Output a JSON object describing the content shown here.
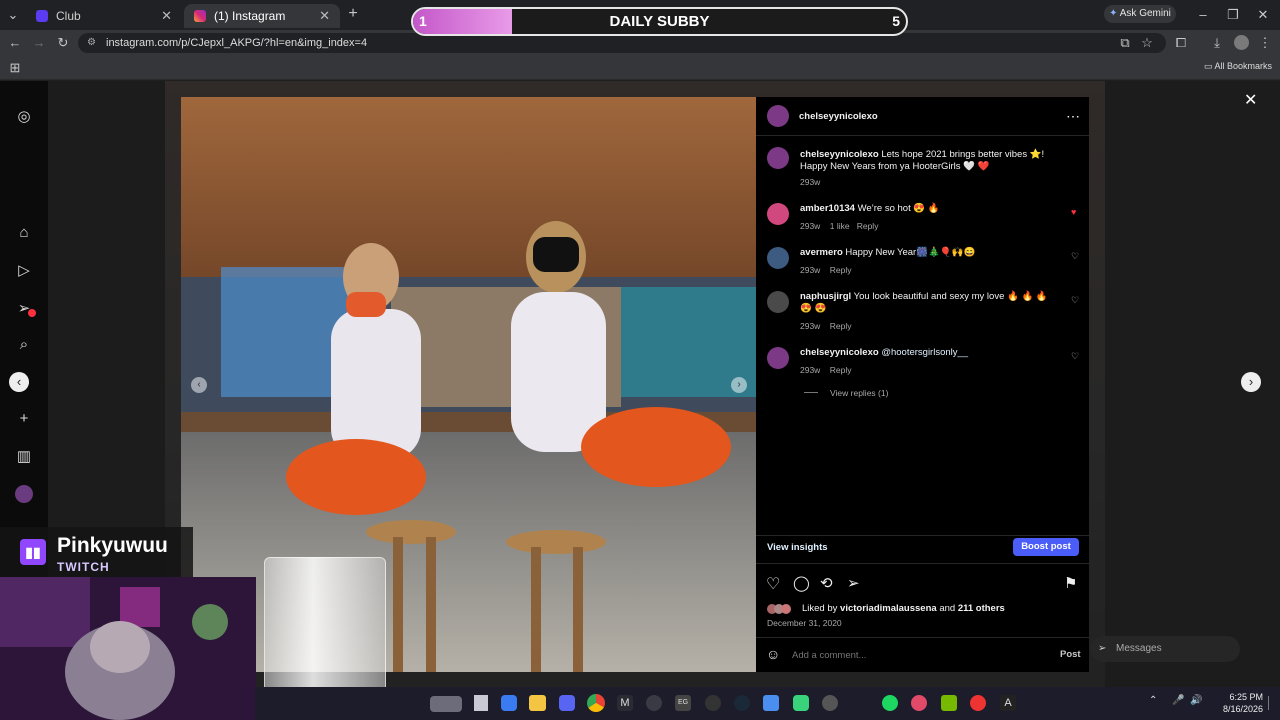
{
  "browser": {
    "tabs": [
      {
        "label": "Club",
        "active": false
      },
      {
        "label": "(1) Instagram",
        "active": true
      }
    ],
    "url": "instagram.com/p/CJepxl_AKPG/?hl=en&img_index=4",
    "ask_gemini": "Ask Gemini",
    "all_bookmarks": "All Bookmarks"
  },
  "overlay": {
    "title": "DAILY SUBBY",
    "current": "1",
    "goal": "5",
    "progress_fraction": 0.2
  },
  "post": {
    "author": "chelseyynicolexo",
    "caption": "Lets hope 2021 brings better vibes ⭐! Happy New Years from ya HooterGirls 🤍 ❤️",
    "caption_time": "293w",
    "comments": [
      {
        "user": "amber10134",
        "text": "We’re so hot 😍 🔥",
        "time": "293w",
        "likes": "1 like",
        "reply": "Reply",
        "liked": true
      },
      {
        "user": "avermero",
        "text": "Happy New Year🎆🎄🎈🙌😄",
        "time": "293w",
        "likes": "",
        "reply": "Reply",
        "liked": false
      },
      {
        "user": "naphusjirgl",
        "text": "You look beautiful and sexy my love 🔥 🔥 🔥 😍 😍",
        "time": "293w",
        "likes": "",
        "reply": "Reply",
        "liked": false
      },
      {
        "user": "chelseyynicolexo",
        "text": "@hootersgirlsonly__",
        "time": "293w",
        "likes": "",
        "reply": "Reply",
        "liked": false
      }
    ],
    "view_replies": "View replies (1)",
    "view_insights": "View insights",
    "boost_post": "Boost post",
    "liked_by_prefix": "Liked by",
    "liked_by_user": "victoriadimalaussena",
    "liked_by_suffix": "and",
    "liked_by_others": "211 others",
    "date": "December 31, 2020",
    "add_comment_placeholder": "Add a comment...",
    "post_button": "Post"
  },
  "messages_label": "Messages",
  "stream": {
    "name": "Pinkyuwuu",
    "platform": "TWITCH"
  },
  "taskbar": {
    "time": "6:25 PM",
    "date": "8/16/2026"
  },
  "colors": {
    "accent_blue": "#4a5df9",
    "link_blue": "#e0f1ff",
    "liked_red": "#ff3040",
    "subby_pink": "#d77ad9"
  }
}
